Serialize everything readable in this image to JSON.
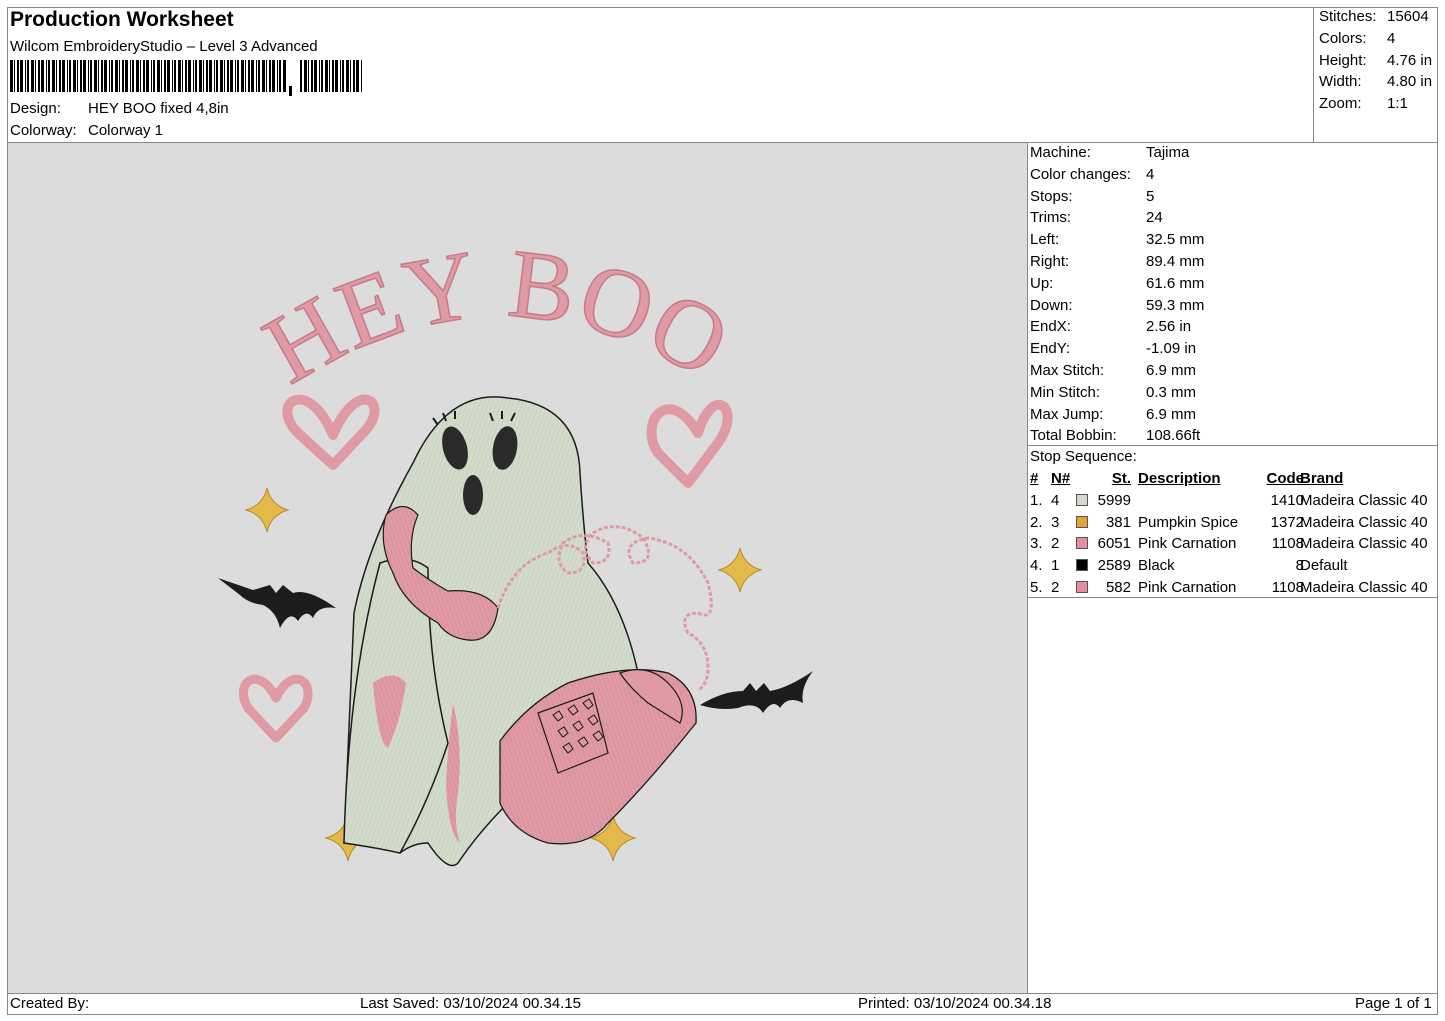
{
  "header": {
    "title": "Production Worksheet",
    "software": "Wilcom EmbroideryStudio – Level 3 Advanced",
    "design_label": "Design:",
    "design_value": "HEY BOO fixed 4,8in",
    "colorway_label": "Colorway:",
    "colorway_value": "Colorway 1"
  },
  "stats": [
    {
      "label": "Stitches:",
      "value": "15604"
    },
    {
      "label": "Colors:",
      "value": "4"
    },
    {
      "label": "Height:",
      "value": "4.76 in"
    },
    {
      "label": "Width:",
      "value": "4.80 in"
    },
    {
      "label": "Zoom:",
      "value": "1:1"
    }
  ],
  "machine_info": [
    {
      "label": "Machine:",
      "value": "Tajima"
    },
    {
      "label": "Color changes:",
      "value": "4"
    },
    {
      "label": "Stops:",
      "value": "5"
    },
    {
      "label": "Trims:",
      "value": "24"
    },
    {
      "label": "Left:",
      "value": "32.5 mm"
    },
    {
      "label": "Right:",
      "value": "89.4 mm"
    },
    {
      "label": "Up:",
      "value": "61.6 mm"
    },
    {
      "label": "Down:",
      "value": "59.3 mm"
    },
    {
      "label": "EndX:",
      "value": "2.56 in"
    },
    {
      "label": "EndY:",
      "value": "-1.09 in"
    },
    {
      "label": "Max Stitch:",
      "value": "6.9 mm"
    },
    {
      "label": "Min Stitch:",
      "value": "0.3 mm"
    },
    {
      "label": "Max Jump:",
      "value": "6.9 mm"
    },
    {
      "label": "Total Bobbin:",
      "value": "108.66ft"
    }
  ],
  "stop_sequence": {
    "title": "Stop Sequence:",
    "headers": {
      "num": "#",
      "n": "N#",
      "st": "St.",
      "desc": "Description",
      "code": "Code",
      "brand": "Brand"
    },
    "rows": [
      {
        "num": "1.",
        "n": "4",
        "color": "#d7d7cf",
        "st": "5999",
        "desc": "",
        "code": "1410",
        "brand": "Madeira Classic 40"
      },
      {
        "num": "2.",
        "n": "3",
        "color": "#e3a23a",
        "st": "381",
        "desc": "Pumpkin Spice",
        "code": "1372",
        "brand": "Madeira Classic 40"
      },
      {
        "num": "3.",
        "n": "2",
        "color": "#e38da0",
        "st": "6051",
        "desc": "Pink Carnation",
        "code": "1108",
        "brand": "Madeira Classic 40"
      },
      {
        "num": "4.",
        "n": "1",
        "color": "#000000",
        "st": "2589",
        "desc": "Black",
        "code": "8",
        "brand": "Default"
      },
      {
        "num": "5.",
        "n": "2",
        "color": "#e38da0",
        "st": "582",
        "desc": "Pink Carnation",
        "code": "1108",
        "brand": "Madeira Classic 40"
      }
    ]
  },
  "design_art": {
    "text": "HEY BOO",
    "pink": "#e09aa4",
    "ghost": "#d3dccb",
    "gold": "#e3b94a",
    "black": "#1c1c1c"
  },
  "footer": {
    "created_by": "Created By:",
    "last_saved": "Last Saved: 03/10/2024 00.34.15",
    "printed": "Printed: 03/10/2024 00.34.18",
    "page": "Page 1 of 1"
  }
}
